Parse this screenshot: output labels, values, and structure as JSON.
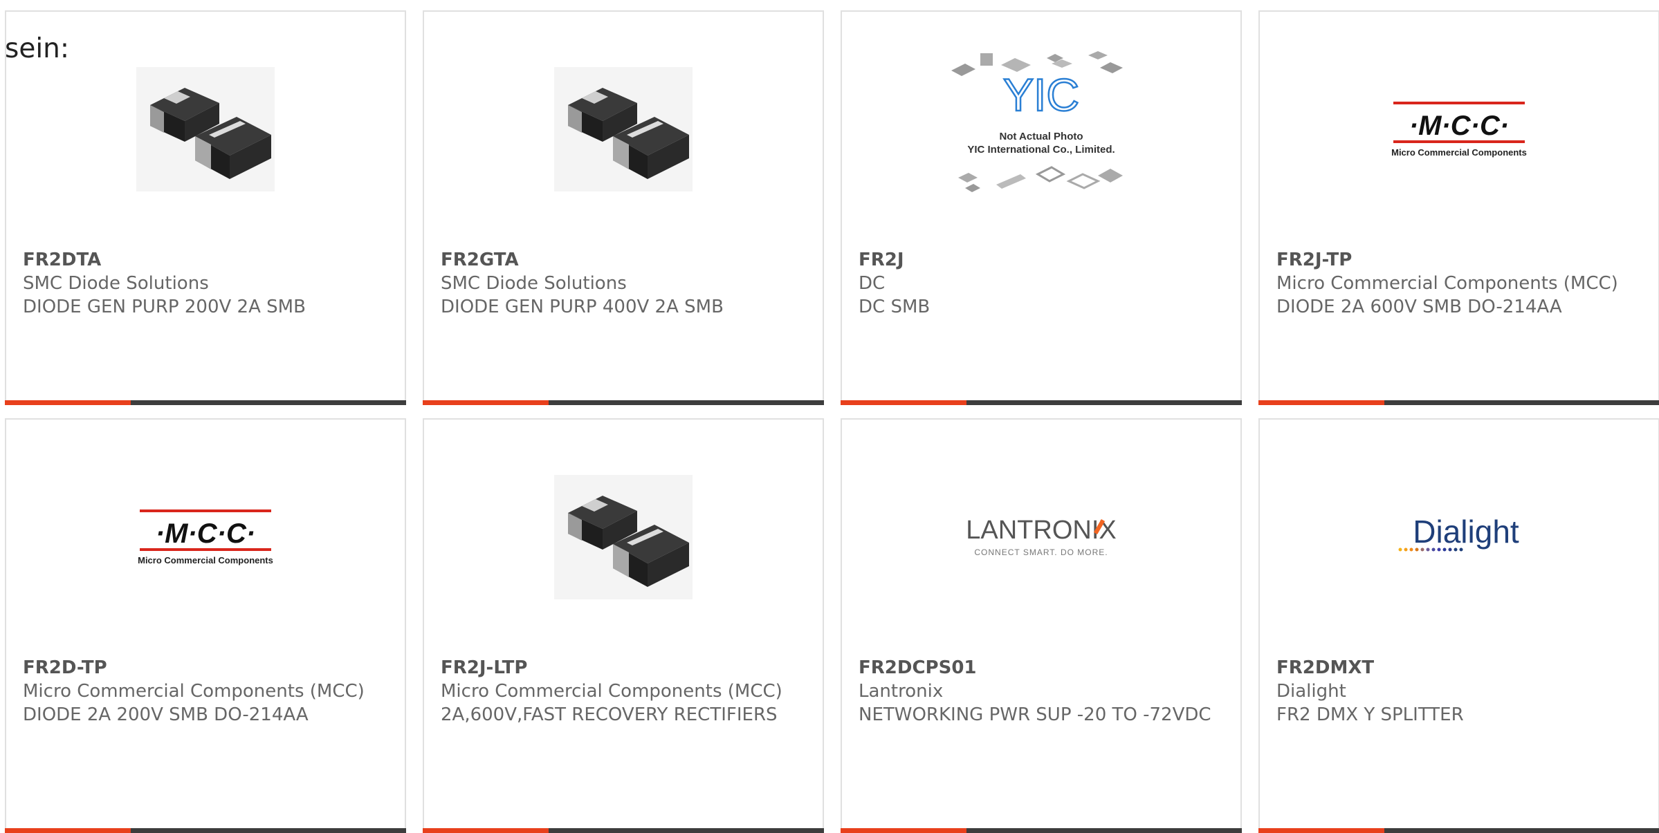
{
  "intro_text": "sein:",
  "cards": [
    {
      "part": "FR2DTA",
      "manufacturer": "SMC Diode Solutions",
      "description": "DIODE GEN PURP 200V 2A SMB",
      "image": "smb-diode"
    },
    {
      "part": "FR2GTA",
      "manufacturer": "SMC Diode Solutions",
      "description": "DIODE GEN PURP 400V 2A SMB",
      "image": "smb-diode"
    },
    {
      "part": "FR2J",
      "manufacturer": "DC",
      "description": "DC SMB",
      "image": "yic-placeholder",
      "image_text": {
        "logo": "YIC",
        "line1": "Not Actual Photo",
        "line2": "YIC International Co., Limited."
      }
    },
    {
      "part": "FR2J-TP",
      "manufacturer": "Micro Commercial Components (MCC)",
      "description": "DIODE 2A 600V SMB DO-214AA",
      "image": "mcc-logo",
      "image_text": {
        "logo": "·M·C·C·",
        "sub": "Micro Commercial Components"
      }
    },
    {
      "part": "FR2D-TP",
      "manufacturer": "Micro Commercial Components (MCC)",
      "description": "DIODE 2A 200V SMB DO-214AA",
      "image": "mcc-logo",
      "image_text": {
        "logo": "·M·C·C·",
        "sub": "Micro Commercial Components"
      }
    },
    {
      "part": "FR2J-LTP",
      "manufacturer": "Micro Commercial Components (MCC)",
      "description": "2A,600V,FAST RECOVERY RECTIFIERS",
      "image": "smb-diode"
    },
    {
      "part": "FR2DCPS01",
      "manufacturer": "Lantronix",
      "description": "NETWORKING PWR SUP -20 TO -72VDC",
      "image": "lantronix-logo",
      "image_text": {
        "logo": "LANTRONIX",
        "sub": "CONNECT SMART. DO MORE."
      }
    },
    {
      "part": "FR2DMXT",
      "manufacturer": "Dialight",
      "description": "FR2 DMX Y SPLITTER",
      "image": "dialight-logo",
      "image_text": {
        "logo": "Dialight"
      }
    }
  ],
  "colors": {
    "accent": "#e8401c",
    "bar": "#3d3d3d",
    "border": "#e0e0e0",
    "mcc_red": "#d9261c",
    "lantronix_orange": "#f26522",
    "dialight_blue": "#1f3f7a"
  }
}
